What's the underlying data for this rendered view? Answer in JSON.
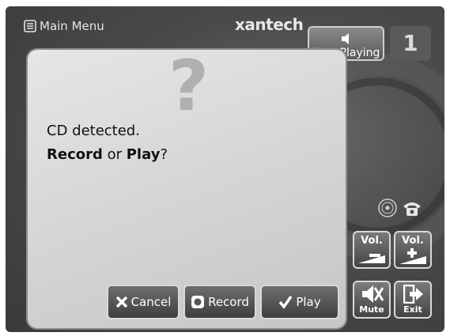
{
  "header": {
    "menu_label": "Main Menu",
    "brand": "xantech",
    "now_playing_label": "Now Playing",
    "zone_number": "1"
  },
  "dialog": {
    "icon": "question-mark-icon",
    "line1": "CD detected.",
    "line2_bold_a": "Record",
    "line2_mid": " or ",
    "line2_bold_b": "Play",
    "line2_end": "?",
    "buttons": {
      "cancel": "Cancel",
      "record": "Record",
      "play": "Play"
    }
  },
  "side_controls": {
    "vol_down": "Vol.",
    "vol_up": "Vol.",
    "mute": "Mute",
    "exit": "Exit"
  },
  "colors": {
    "background": "#4a4a4a",
    "dialog": "#d8d8d8",
    "button": "#555555"
  }
}
